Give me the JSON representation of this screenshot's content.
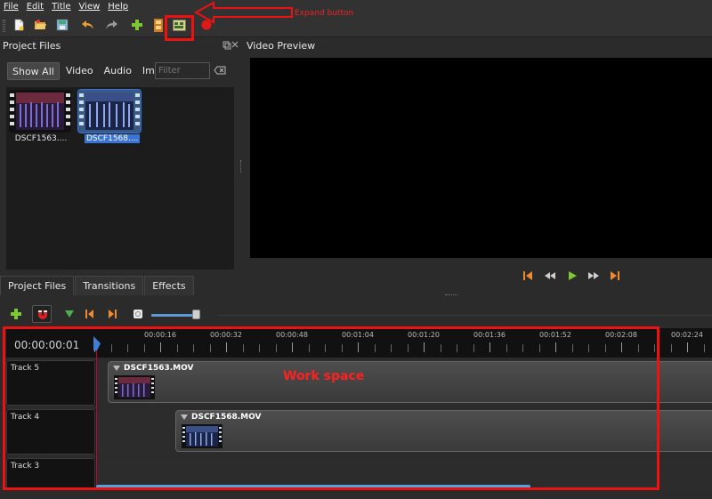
{
  "menu": [
    "File",
    "Edit",
    "Title",
    "View",
    "Help"
  ],
  "annotations": {
    "expand_label": "Expand button",
    "workspace_label": "Work space",
    "color": "#ee1111"
  },
  "project_files": {
    "title": "Project Files",
    "filters": [
      "Show All",
      "Video",
      "Audio",
      "Image"
    ],
    "filter_placeholder": "Filter",
    "files": [
      {
        "label": "DSCF1563....",
        "selected": false
      },
      {
        "label": "DSCF1568....",
        "selected": true
      }
    ]
  },
  "tabs": [
    "Project Files",
    "Transitions",
    "Effects"
  ],
  "video_preview": {
    "title": "Video Preview"
  },
  "timeline": {
    "timecode": "00:00:00:01",
    "ticks": [
      "00:00:16",
      "00:00:32",
      "00:00:48",
      "00:01:04",
      "00:01:20",
      "00:01:36",
      "00:01:52",
      "00:02:08",
      "00:02:24"
    ],
    "tracks": [
      {
        "name": "Track 5",
        "clip": "DSCF1563.MOV"
      },
      {
        "name": "Track 4",
        "clip": "DSCF1568.MOV"
      },
      {
        "name": "Track 3",
        "clip": ""
      }
    ],
    "playhead_color": "#c8002a",
    "accent_color": "#5aa0d8"
  },
  "icons": {
    "toolbar": [
      "new-project-icon",
      "open-project-icon",
      "save-project-icon",
      "undo-icon",
      "redo-icon",
      "import-files-icon",
      "profile-icon",
      "fullscreen-icon",
      "export-video-icon"
    ],
    "timeline": [
      "add-track-icon",
      "snapping-icon",
      "add-marker-icon",
      "previous-marker-icon",
      "next-marker-icon",
      "zoom-icon"
    ],
    "preview": [
      "jump-start-icon",
      "rewind-icon",
      "play-icon",
      "fast-forward-icon",
      "jump-end-icon"
    ]
  }
}
